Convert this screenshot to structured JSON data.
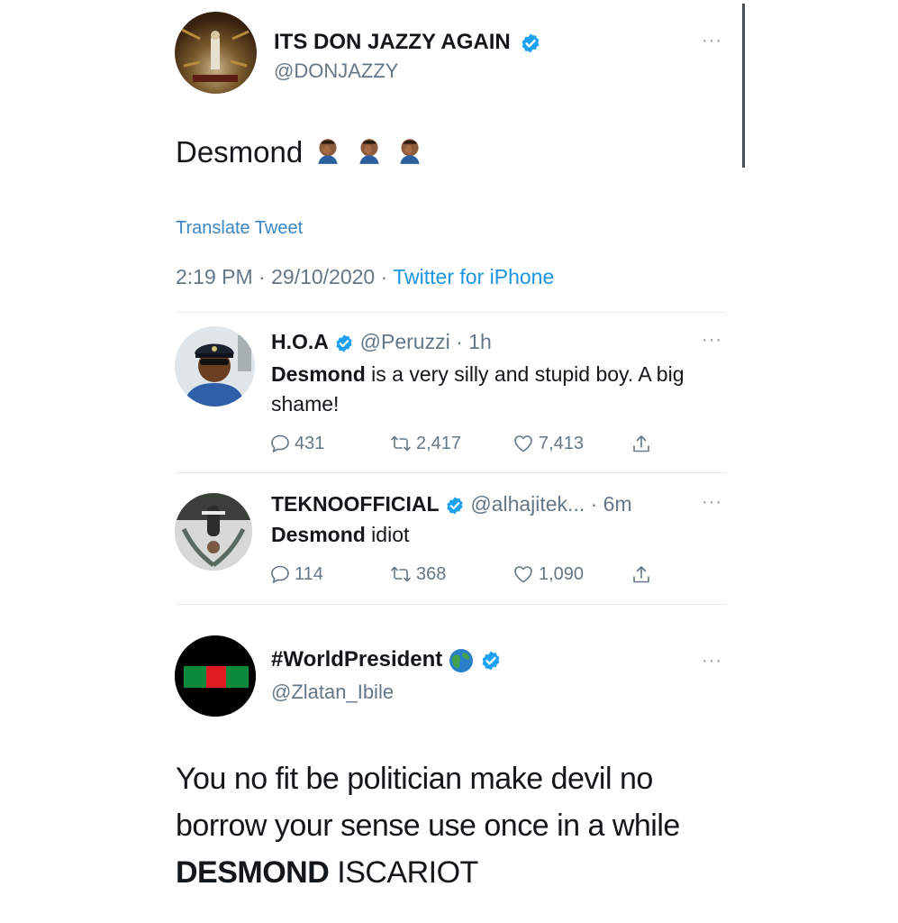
{
  "main_tweet": {
    "display_name": "ITS DON JAZZY AGAIN",
    "handle": "@DONJAZZY",
    "text": "Desmond",
    "emoji": "🤦🏾‍♂️🤦🏾‍♂️🤦🏾‍♂️",
    "translate": "Translate Tweet",
    "time": "2:19 PM",
    "sep1": "·",
    "date": "29/10/2020",
    "sep2": "·",
    "source": "Twitter for iPhone"
  },
  "reply1": {
    "display_name": "H.O.A",
    "handle": "@Peruzzi",
    "age": "· 1h",
    "text_bold": "Desmond",
    "text_rest": " is a very silly and stupid boy. A big shame!",
    "replies": "431",
    "retweets": "2,417",
    "likes": "7,413"
  },
  "reply2": {
    "display_name": "TEKNOOFFICIAL",
    "handle": "@alhajitek...",
    "age": "· 6m",
    "text_bold": "Desmond",
    "text_rest": " idiot",
    "replies": "114",
    "retweets": "368",
    "likes": "1,090"
  },
  "tweet3": {
    "display_name": "#WorldPresident",
    "handle": "@Zlatan_Ibile",
    "text_line1": "You no fit be politician make devil no",
    "text_line2": "borrow your sense use once in a while",
    "text_bold": "DESMOND",
    "text_rest": " ISCARIOT"
  },
  "colors": {
    "verified": "#1da1f2",
    "link": "#1b95e0",
    "muted": "#657786",
    "divider": "#e6ecf0"
  },
  "icons": [
    "verified-badge-icon",
    "more-options-icon",
    "reply-icon",
    "retweet-icon",
    "like-icon",
    "share-icon",
    "globe-emoji-icon",
    "facepalm-emoji-icon"
  ]
}
